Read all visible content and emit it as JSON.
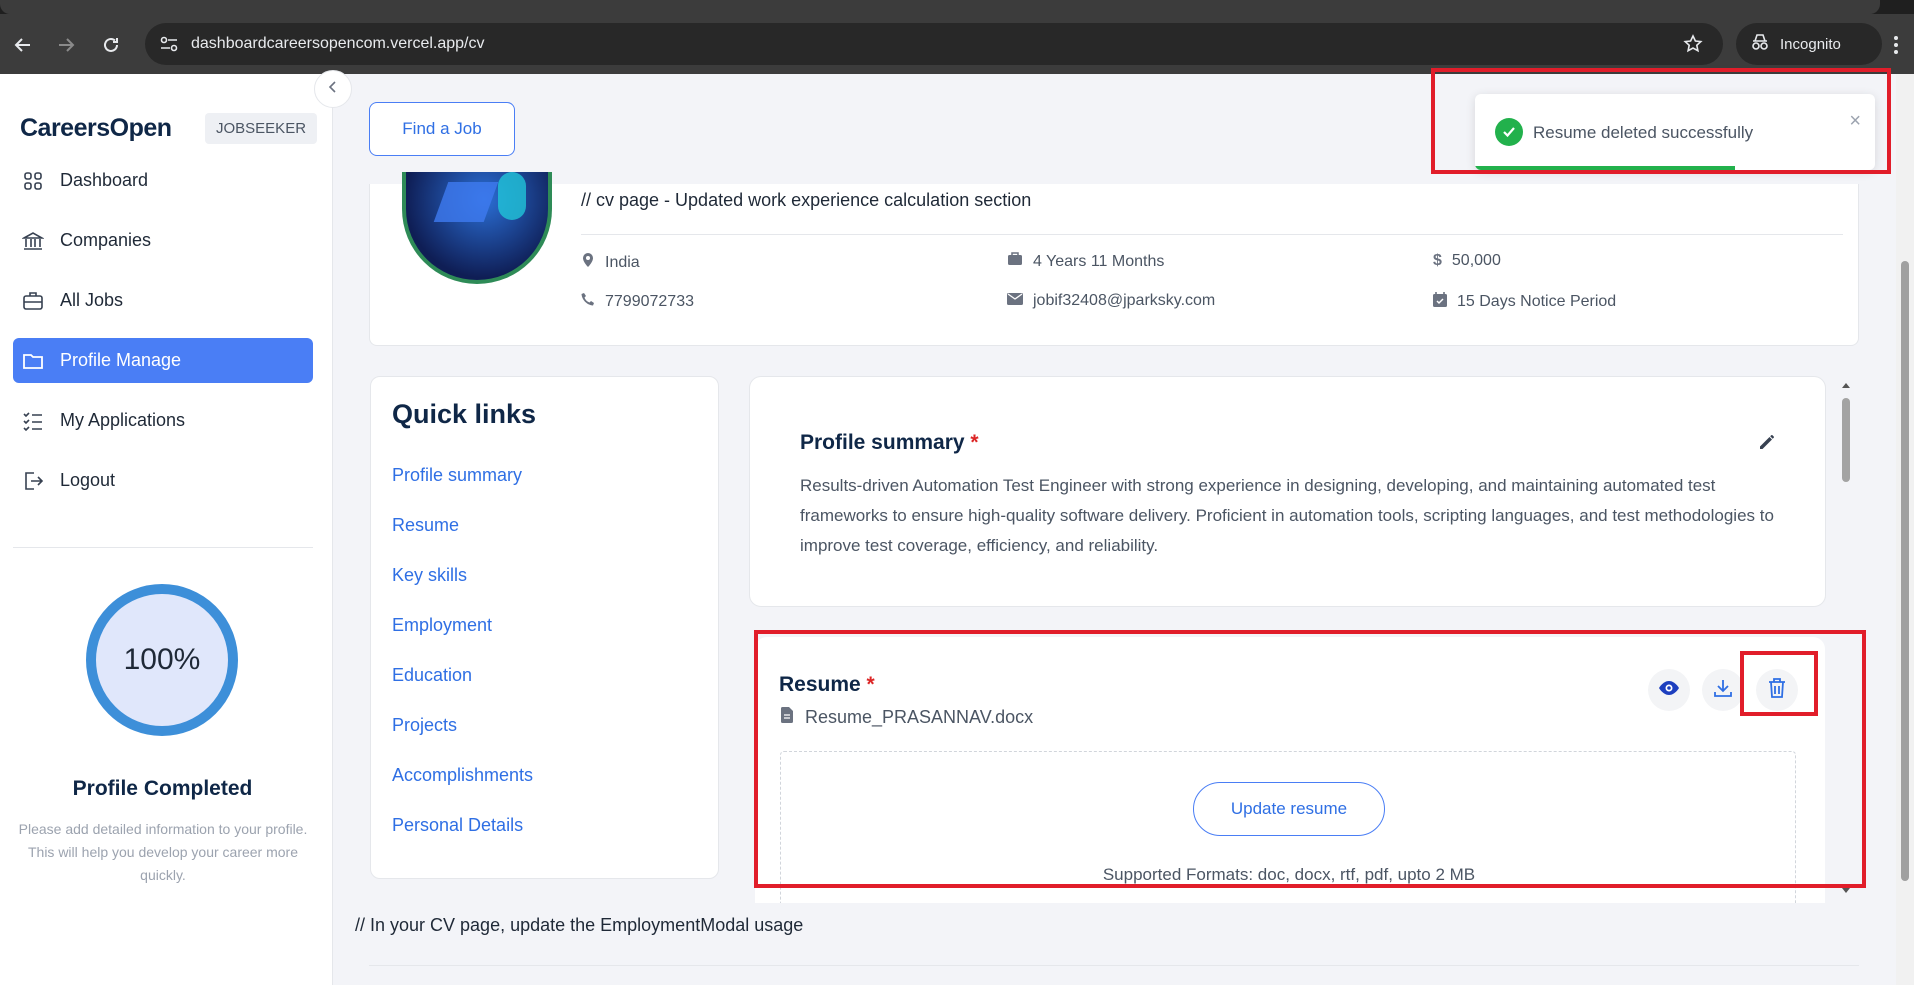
{
  "browser": {
    "url": "dashboardcareersopencom.vercel.app/cv",
    "profile_label": "Incognito"
  },
  "sidebar": {
    "logo": "CareersOpen",
    "role_badge": "JOBSEEKER",
    "items": [
      {
        "label": "Dashboard",
        "icon": "grid-icon",
        "active": false
      },
      {
        "label": "Companies",
        "icon": "bank-icon",
        "active": false
      },
      {
        "label": "All Jobs",
        "icon": "briefcase-icon",
        "active": false
      },
      {
        "label": "Profile Manage",
        "icon": "folder-icon",
        "active": true
      },
      {
        "label": "My Applications",
        "icon": "list-check-icon",
        "active": false
      },
      {
        "label": "Logout",
        "icon": "logout-icon",
        "active": false
      }
    ],
    "progress_percent": "100%",
    "progress_title": "Profile Completed",
    "progress_hint": "Please add detailed information to your profile. This will help you develop your career more quickly."
  },
  "topbar": {
    "find_job_label": "Find a Job"
  },
  "header": {
    "note": "// cv page - Updated work experience calculation section",
    "location": "India",
    "experience": "4 Years 11 Months",
    "salary": "50,000",
    "phone": "7799072733",
    "email": "jobif32408@jparksky.com",
    "notice": "15 Days Notice Period"
  },
  "quick_links": {
    "title": "Quick links",
    "links": [
      "Profile summary",
      "Resume",
      "Key skills",
      "Employment",
      "Education",
      "Projects",
      "Accomplishments",
      "Personal Details"
    ]
  },
  "summary": {
    "title": "Profile summary",
    "required_mark": "*",
    "text": "Results-driven Automation Test Engineer with strong experience in designing, developing, and maintaining automated test frameworks to ensure high-quality software delivery. Proficient in automation tools, scripting languages, and test methodologies to improve test coverage, efficiency, and reliability."
  },
  "resume": {
    "title": "Resume",
    "required_mark": "*",
    "file_name": "Resume_PRASANNAV.docx",
    "update_label": "Update resume",
    "formats": "Supported Formats: doc, docx, rtf, pdf, upto 2 MB"
  },
  "bottom_note": "// In your CV page, update the EmploymentModal usage",
  "toast": {
    "message": "Resume deleted successfully",
    "close": "×",
    "progress": 0.65
  },
  "colors": {
    "accent": "#4a7ef5",
    "link": "#2f6fe4",
    "success": "#22b14c",
    "highlight": "#e11d2a",
    "navy": "#0f2747"
  }
}
